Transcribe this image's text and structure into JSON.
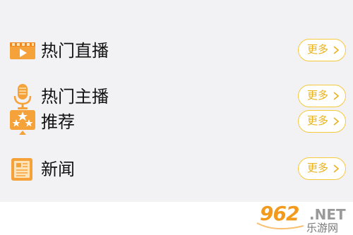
{
  "sections": [
    {
      "label": "热门直播",
      "more_label": "更多",
      "icon": "live-video-icon"
    },
    {
      "label": "热门主播",
      "more_label": "更多",
      "icon": "microphone-icon"
    },
    {
      "label": "推荐",
      "more_label": "更多",
      "icon": "stars-recommend-icon"
    },
    {
      "label": "新闻",
      "more_label": "更多",
      "icon": "news-icon"
    }
  ],
  "watermark": {
    "number": "962",
    "domain": ".NET",
    "site_name": "乐游网"
  },
  "colors": {
    "background": "#f2f2f4",
    "accent_orange": "#f5a23a",
    "more_border": "#f6c93c",
    "more_text": "#e9b21b"
  }
}
